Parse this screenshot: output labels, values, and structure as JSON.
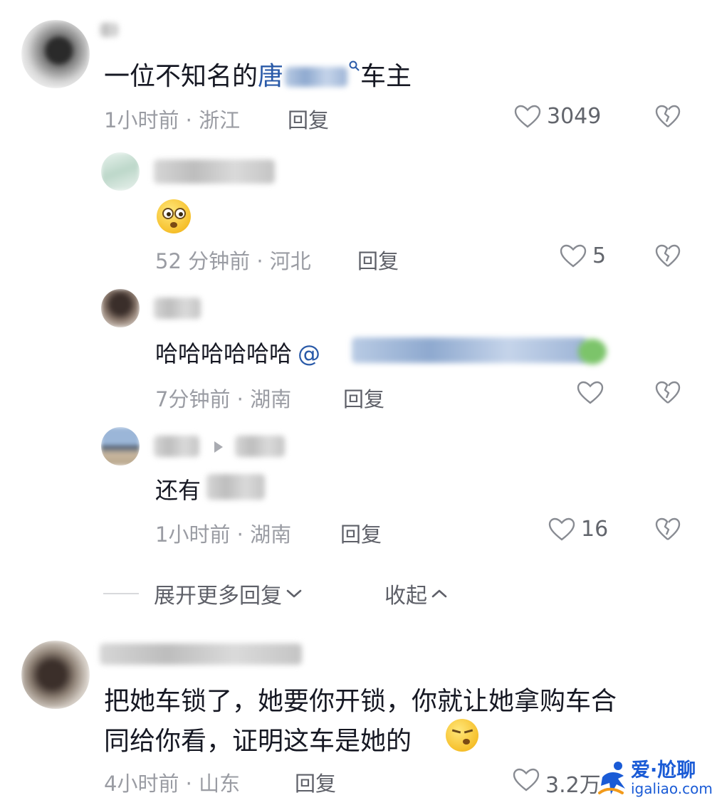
{
  "comments": [
    {
      "text_prefix": "一位不知名的",
      "text_link": "唐",
      "text_suffix": "车主",
      "meta": "1小时前 · 浙江",
      "reply_label": "回复",
      "likes": "3049"
    },
    {
      "meta": "4小时前 · 山东",
      "reply_label": "回复",
      "likes": "3.2万",
      "line1": "把她车锁了，她要你开锁，你就让她拿购车合",
      "line2": "同给你看，证明这车是她的"
    }
  ],
  "replies": [
    {
      "meta": "52 分钟前 · 河北",
      "reply_label": "回复",
      "likes": "5"
    },
    {
      "text": "哈哈哈哈哈哈",
      "mention": "@",
      "meta": "7分钟前 · 湖南",
      "reply_label": "回复",
      "likes": ""
    },
    {
      "text": "还有",
      "meta": "1小时前 · 湖南",
      "reply_label": "回复",
      "likes": "16"
    }
  ],
  "thread_controls": {
    "expand_label": "展开更多回复",
    "collapse_label": "收起"
  },
  "watermark": {
    "brand": "爱·尬聊",
    "domain": "igaliao.com"
  },
  "icons": {
    "like": "heart-outline-icon",
    "dislike": "broken-heart-icon",
    "search": "search-icon",
    "expand": "chevron-down-icon",
    "collapse": "chevron-up-icon"
  },
  "colors": {
    "link": "#2a5aa8",
    "meta": "#9a9ca3",
    "watermark": "#1a5bd6"
  }
}
